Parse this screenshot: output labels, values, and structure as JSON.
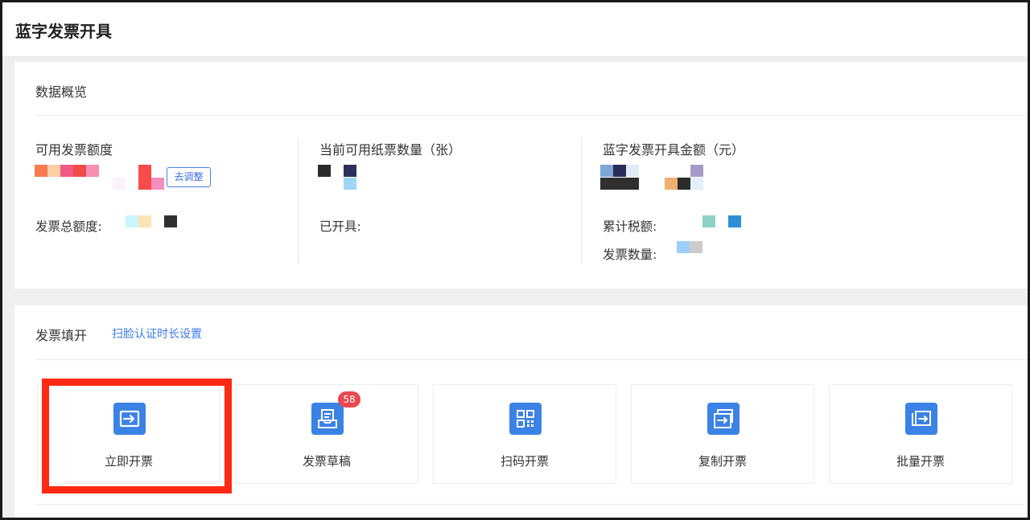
{
  "page": {
    "title": "蓝字发票开具"
  },
  "overview": {
    "title": "数据概览",
    "available_quota": {
      "label": "可用发票额度",
      "adjust_button": "去调整"
    },
    "total_quota": {
      "label": "发票总额度:"
    },
    "paper_count": {
      "label": "当前可用纸票数量（张）"
    },
    "issued": {
      "label": "已开具:"
    },
    "blue_amount": {
      "label": "蓝字发票开具金额（元）"
    },
    "total_tax": {
      "label": "累计税额:"
    },
    "invoice_count": {
      "label": "发票数量:"
    }
  },
  "fill": {
    "title": "发票填开",
    "face_auth_link": "扫脸认证时长设置",
    "tiles": [
      {
        "label": "立即开票",
        "icon": "issue-now-icon"
      },
      {
        "label": "发票草稿",
        "icon": "draft-icon",
        "badge": "58"
      },
      {
        "label": "扫码开票",
        "icon": "qr-code-icon"
      },
      {
        "label": "复制开票",
        "icon": "copy-invoice-icon"
      },
      {
        "label": "批量开票",
        "icon": "batch-invoice-icon"
      }
    ]
  },
  "colors": {
    "accent": "#3b82e6",
    "link": "#3b7bea",
    "badge": "#e8484e",
    "highlight": "#ff2a12"
  }
}
